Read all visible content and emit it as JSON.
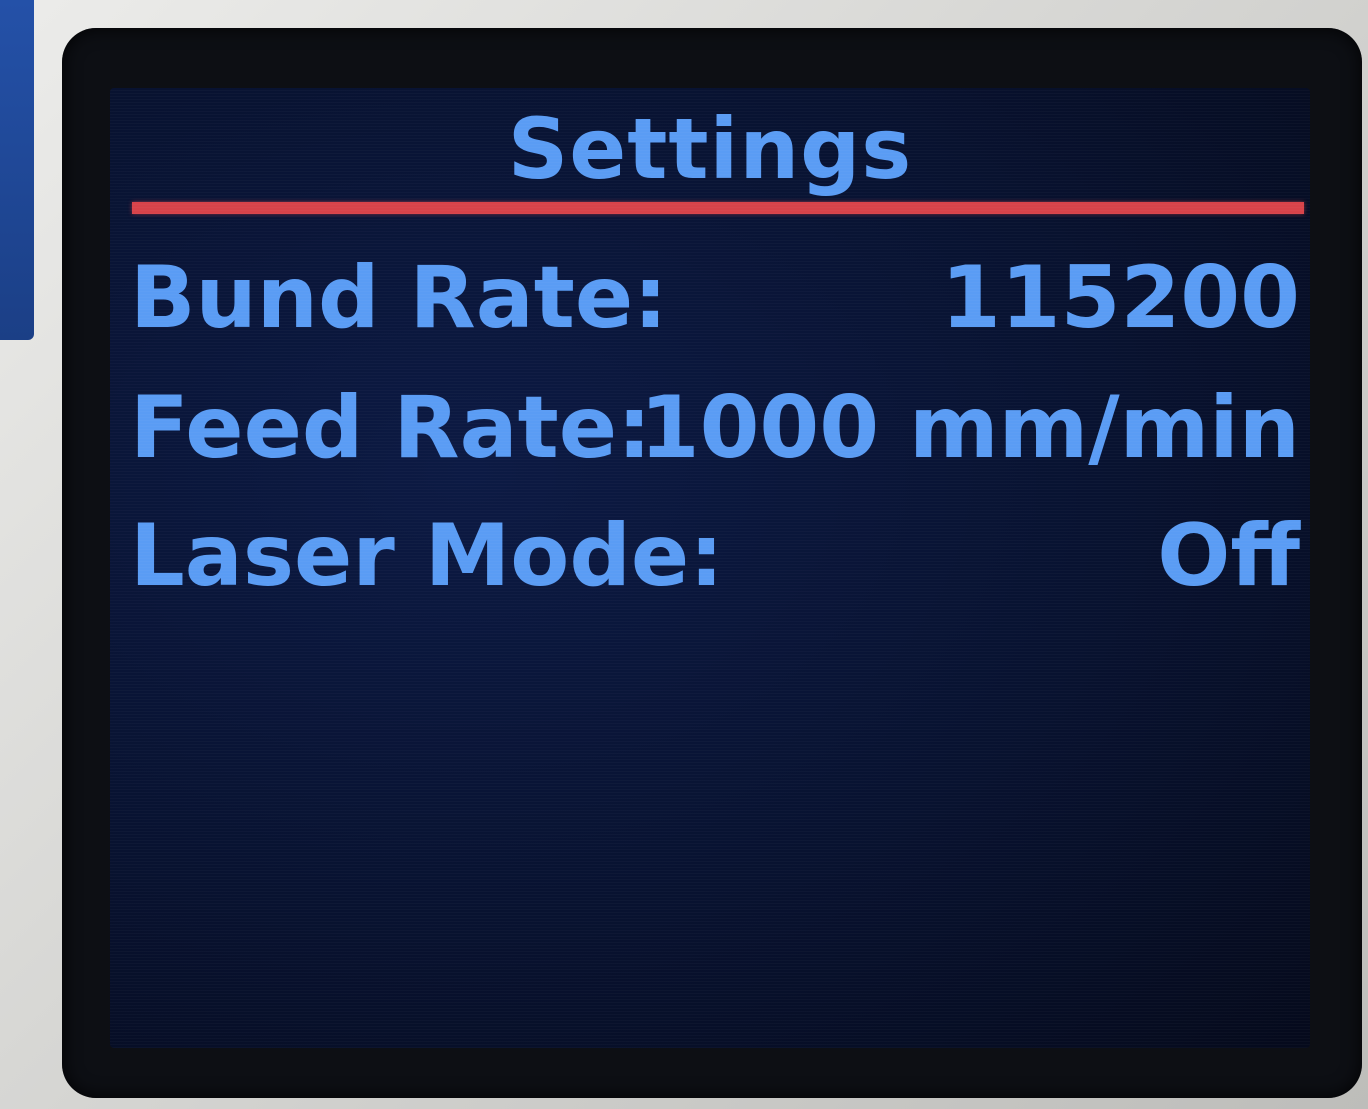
{
  "screen": {
    "title": "Settings",
    "accent_color": "#5a9cf4",
    "divider_color": "#d8434a",
    "rows": [
      {
        "label": "Bund Rate:",
        "value": "115200"
      },
      {
        "label": "Feed Rate:",
        "value": "1000 mm/min"
      },
      {
        "label": "Laser Mode:",
        "value": "Off"
      }
    ]
  }
}
